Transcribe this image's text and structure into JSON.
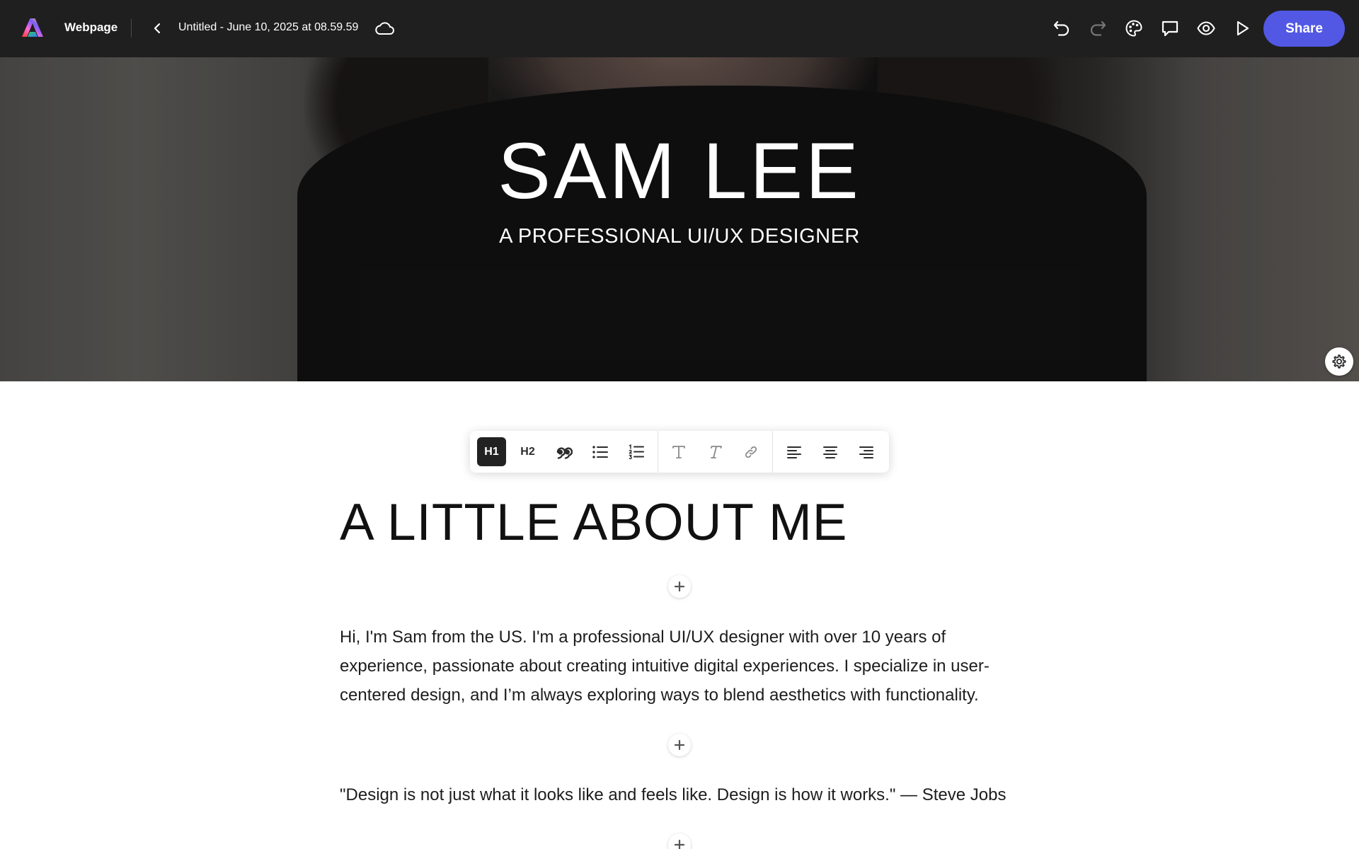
{
  "header": {
    "app_name": "Webpage",
    "doc_title": "Untitled - June 10, 2025 at 08.59.59",
    "share_label": "Share",
    "icons": [
      "app-logo-icon",
      "chevron-left-icon",
      "cloud-icon",
      "undo-icon",
      "redo-icon",
      "theme-palette-icon",
      "comment-icon",
      "preview-eye-icon",
      "play-icon"
    ]
  },
  "hero": {
    "name": "SAM LEE",
    "subtitle": "A PROFESSIONAL UI/UX DESIGNER"
  },
  "format_toolbar": {
    "h1": "H1",
    "h2": "H2",
    "active": "H1"
  },
  "content": {
    "heading": "A LITTLE ABOUT ME",
    "bio": "Hi, I'm Sam from the US. I'm a professional UI/UX designer with over 10 years of experience, passionate about creating intuitive digital experiences. I specialize in user-centered design, and I’m always exploring ways to blend aesthetics with functionality.",
    "quote": "\"Design is not just what it looks like and feels like. Design is how it works.\" — Steve Jobs"
  },
  "colors": {
    "topbar_bg": "#1f1f1f",
    "share_accent": "#5258e4",
    "active_format": "#222222"
  }
}
